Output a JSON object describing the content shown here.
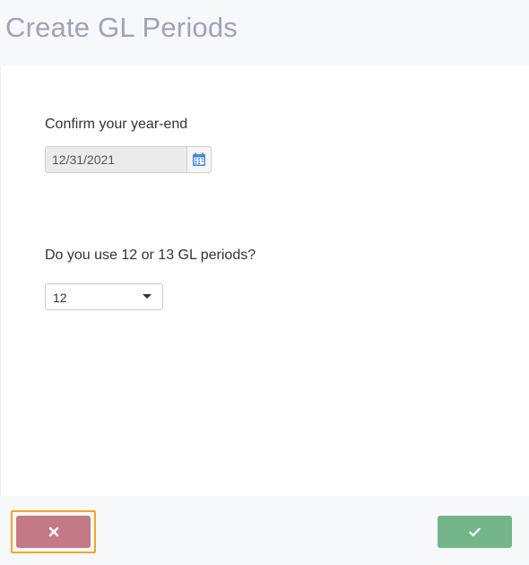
{
  "header": {
    "title": "Create GL Periods"
  },
  "form": {
    "year_end_label": "Confirm your year-end",
    "year_end_value": "12/31/2021",
    "periods_label": "Do you use 12 or 13 GL periods?",
    "periods_selected": "12"
  },
  "footer": {
    "cancel_icon": "close-icon",
    "confirm_icon": "check-icon"
  },
  "colors": {
    "cancel": "#c47a86",
    "confirm": "#74b58a",
    "focus_outline": "#f5a623",
    "title": "#9fa3b8",
    "calendar": "#4a84d4"
  }
}
